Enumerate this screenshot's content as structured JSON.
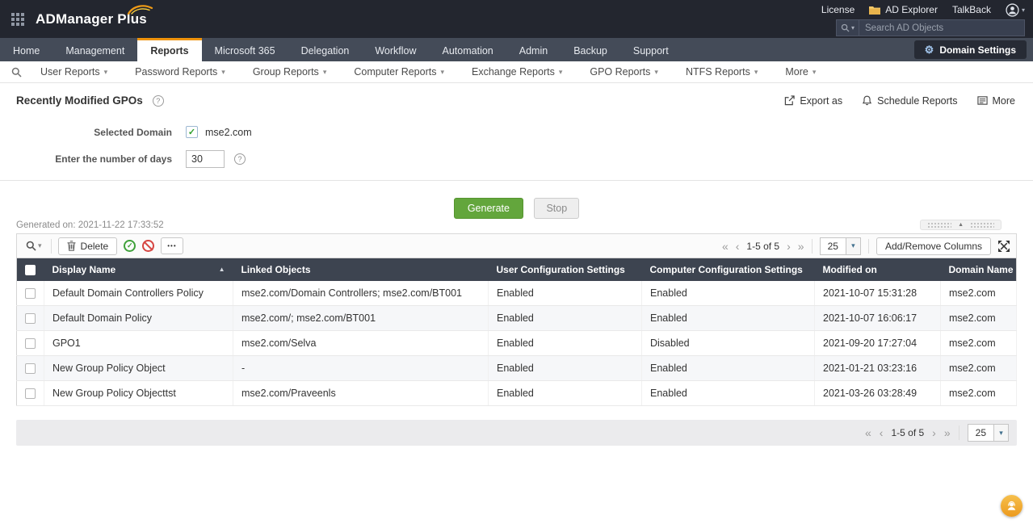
{
  "header": {
    "logo_primary": "ADManager",
    "logo_secondary": "Plus",
    "license": "License",
    "ad_explorer": "AD Explorer",
    "talkback": "TalkBack",
    "search_placeholder": "Search AD Objects"
  },
  "nav": {
    "tabs": [
      "Home",
      "Management",
      "Reports",
      "Microsoft 365",
      "Delegation",
      "Workflow",
      "Automation",
      "Admin",
      "Backup",
      "Support"
    ],
    "active_tab": "Reports",
    "domain_settings": "Domain Settings"
  },
  "reports_nav": {
    "items": [
      "User Reports",
      "Password Reports",
      "Group Reports",
      "Computer Reports",
      "Exchange Reports",
      "GPO Reports",
      "NTFS Reports",
      "More"
    ]
  },
  "page": {
    "title": "Recently Modified GPOs",
    "actions": {
      "export_as": "Export as",
      "schedule_reports": "Schedule Reports",
      "more": "More"
    }
  },
  "form": {
    "selected_domain_label": "Selected Domain",
    "domain_value": "mse2.com",
    "days_label": "Enter the number of days",
    "days_value": "30",
    "generate": "Generate",
    "stop": "Stop",
    "generated_on": "Generated on: 2021-11-22 17:33:52"
  },
  "toolbar": {
    "delete": "Delete",
    "pagination_text": "1-5 of 5",
    "page_size": "25",
    "add_remove_columns": "Add/Remove Columns"
  },
  "table": {
    "columns": [
      "Display Name",
      "Linked Objects",
      "User Configuration Settings",
      "Computer Configuration Settings",
      "Modified on",
      "Domain Name"
    ],
    "rows": [
      {
        "display_name": "Default Domain Controllers Policy",
        "linked_objects": "mse2.com/Domain Controllers; mse2.com/BT001",
        "user_config": "Enabled",
        "computer_config": "Enabled",
        "modified_on": "2021-10-07 15:31:28",
        "domain_name": "mse2.com"
      },
      {
        "display_name": "Default Domain Policy",
        "linked_objects": "mse2.com/; mse2.com/BT001",
        "user_config": "Enabled",
        "computer_config": "Enabled",
        "modified_on": "2021-10-07 16:06:17",
        "domain_name": "mse2.com"
      },
      {
        "display_name": "GPO1",
        "linked_objects": "mse2.com/Selva",
        "user_config": "Enabled",
        "computer_config": "Disabled",
        "modified_on": "2021-09-20 17:27:04",
        "domain_name": "mse2.com"
      },
      {
        "display_name": "New Group Policy Object",
        "linked_objects": "-",
        "user_config": "Enabled",
        "computer_config": "Enabled",
        "modified_on": "2021-01-21 03:23:16",
        "domain_name": "mse2.com"
      },
      {
        "display_name": "New Group Policy Objecttst",
        "linked_objects": "mse2.com/Praveenls",
        "user_config": "Enabled",
        "computer_config": "Enabled",
        "modified_on": "2021-03-26 03:28:49",
        "domain_name": "mse2.com"
      }
    ]
  },
  "footer": {
    "pagination_text": "1-5 of 5",
    "page_size": "25"
  },
  "icons": {
    "gear": "⚙",
    "caret_down": "▾",
    "sort_asc": "▲",
    "first": "«",
    "prev": "‹",
    "next": "›",
    "last": "»",
    "check": "✓",
    "ellipsis": "•••",
    "collapse_up": "▲"
  },
  "colors": {
    "accent_orange": "#ee920b",
    "generate_green": "#63a63c",
    "header_dark": "#23262f",
    "table_header_dark": "#3d4450"
  }
}
